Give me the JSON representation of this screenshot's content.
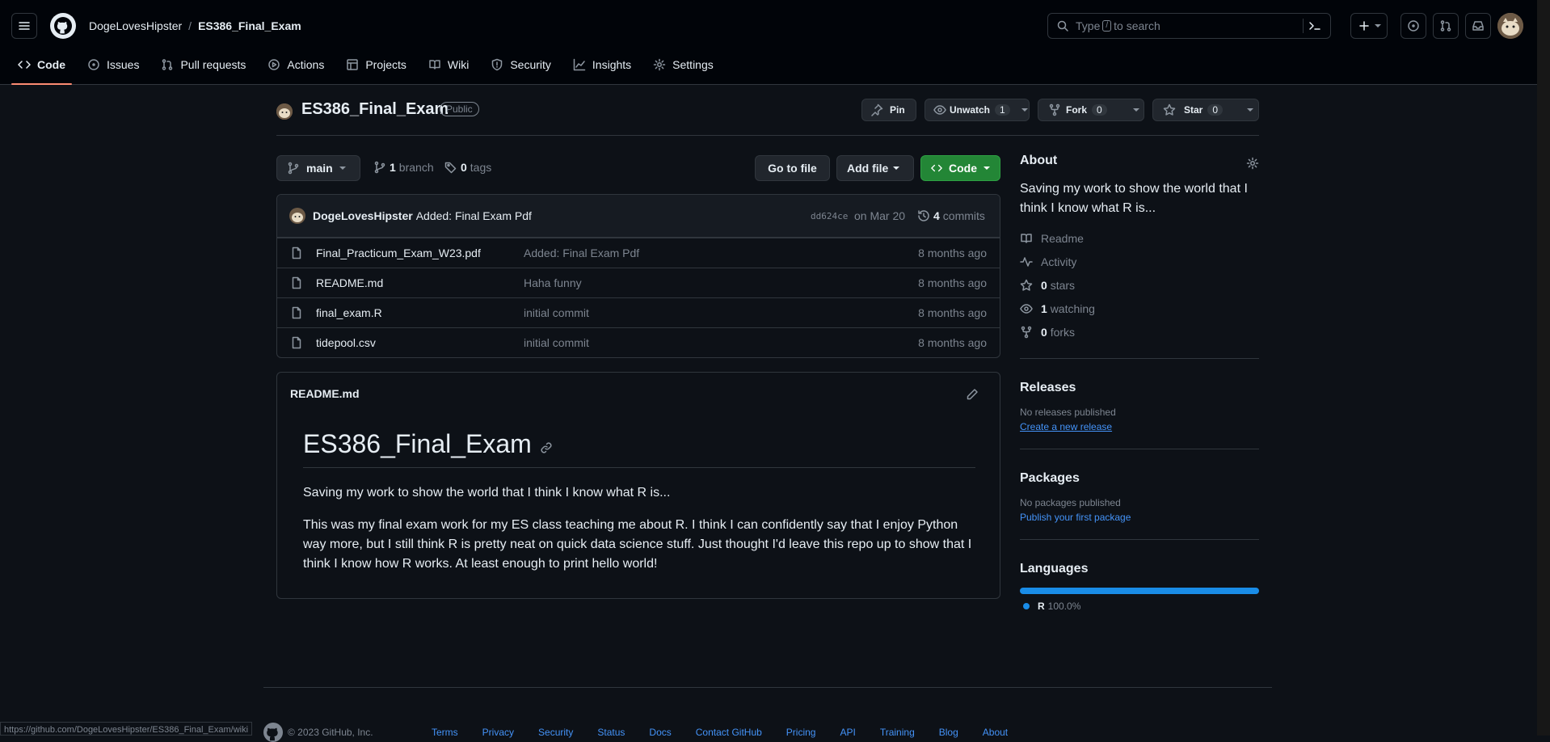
{
  "header": {
    "owner": "DogeLovesHipster",
    "separator": "/",
    "repo": "ES386_Final_Exam",
    "search_prefix": "Type",
    "search_key": "/",
    "search_suffix": "to search"
  },
  "tabs": [
    {
      "label": "Code",
      "icon": "code-icon",
      "selected": true
    },
    {
      "label": "Issues",
      "icon": "issue-icon"
    },
    {
      "label": "Pull requests",
      "icon": "pull-request-icon"
    },
    {
      "label": "Actions",
      "icon": "play-icon"
    },
    {
      "label": "Projects",
      "icon": "table-icon"
    },
    {
      "label": "Wiki",
      "icon": "book-icon"
    },
    {
      "label": "Security",
      "icon": "shield-icon"
    },
    {
      "label": "Insights",
      "icon": "graph-icon"
    },
    {
      "label": "Settings",
      "icon": "gear-icon"
    }
  ],
  "repo": {
    "name": "ES386_Final_Exam",
    "visibility": "Public",
    "pin_label": "Pin",
    "unwatch_label": "Unwatch",
    "unwatch_count": "1",
    "fork_label": "Fork",
    "fork_count": "0",
    "star_label": "Star",
    "star_count": "0"
  },
  "toolbar": {
    "branch": "main",
    "branches_count": "1",
    "branches_label": "branch",
    "tags_count": "0",
    "tags_label": "tags",
    "goto_file": "Go to file",
    "add_file": "Add file",
    "code": "Code"
  },
  "commit": {
    "author": "DogeLovesHipster",
    "message": "Added: Final Exam Pdf",
    "sha": "dd624ce",
    "date": "on Mar 20",
    "commits_count": "4",
    "commits_label": "commits"
  },
  "files": [
    {
      "name": "Final_Practicum_Exam_W23.pdf",
      "message": "Added: Final Exam Pdf",
      "age": "8 months ago"
    },
    {
      "name": "README.md",
      "message": "Haha funny",
      "age": "8 months ago"
    },
    {
      "name": "final_exam.R",
      "message": "initial commit",
      "age": "8 months ago"
    },
    {
      "name": "tidepool.csv",
      "message": "initial commit",
      "age": "8 months ago"
    }
  ],
  "readme": {
    "filename": "README.md",
    "heading": "ES386_Final_Exam",
    "para1": "Saving my work to show the world that I think I know what R is...",
    "para2": "This was my final exam work for my ES class teaching me about R. I think I can confidently say that I enjoy Python way more, but I still think R is pretty neat on quick data science stuff. Just thought I'd leave this repo up to show that I think I know how R works. At least enough to print hello world!"
  },
  "about": {
    "title": "About",
    "description": "Saving my work to show the world that I think I know what R is...",
    "readme": "Readme",
    "activity": "Activity",
    "stars_count": "0",
    "stars_label": "stars",
    "watching_count": "1",
    "watching_label": "watching",
    "forks_count": "0",
    "forks_label": "forks"
  },
  "releases": {
    "title": "Releases",
    "none": "No releases published",
    "link": "Create a new release"
  },
  "packages": {
    "title": "Packages",
    "none": "No packages published",
    "link": "Publish your first package"
  },
  "languages": {
    "title": "Languages",
    "name": "R",
    "percent": "100.0%",
    "share": 1.0,
    "color": "#198ce7"
  },
  "footer": {
    "copyright": "© 2023 GitHub, Inc.",
    "links": [
      "Terms",
      "Privacy",
      "Security",
      "Status",
      "Docs",
      "Contact GitHub",
      "Pricing",
      "API",
      "Training",
      "Blog",
      "About"
    ]
  },
  "status_url": "https://github.com/DogeLovesHipster/ES386_Final_Exam/wiki"
}
